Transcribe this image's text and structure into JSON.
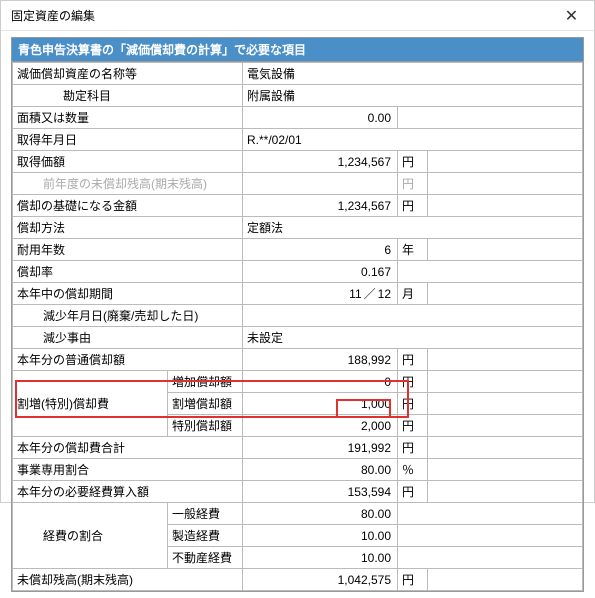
{
  "window": {
    "title": "固定資産の編集"
  },
  "panel": {
    "header": "青色申告決算書の「減価償却費の計算」で必要な項目"
  },
  "rows": {
    "name": {
      "label": "減価償却資産の名称等",
      "value": "電気設備"
    },
    "account": {
      "label": "勘定科目",
      "value": "附属設備"
    },
    "area": {
      "label": "面積又は数量",
      "value": "0.00"
    },
    "acq_date": {
      "label": "取得年月日",
      "value": "R.**/02/01"
    },
    "acq_cost": {
      "label": "取得価額",
      "value": "1,234,567",
      "unit": "円"
    },
    "prev_bal": {
      "label": "前年度の未償却残高(期末残高)",
      "value": "",
      "unit": "円"
    },
    "base": {
      "label": "償却の基礎になる金額",
      "value": "1,234,567",
      "unit": "円"
    },
    "method": {
      "label": "償却方法",
      "value": "定額法"
    },
    "life": {
      "label": "耐用年数",
      "value": "6",
      "unit": "年"
    },
    "rate": {
      "label": "償却率",
      "value": "0.167"
    },
    "period": {
      "label": "本年中の償却期間",
      "v1": "11",
      "v2": "12",
      "unit": "月"
    },
    "dec_date": {
      "label": "減少年月日(廃棄/売却した日)",
      "value": ""
    },
    "dec_reason": {
      "label": "減少事由",
      "value": "未設定"
    },
    "ordinary": {
      "label": "本年分の普通償却額",
      "value": "188,992",
      "unit": "円"
    },
    "special_grp": {
      "label": "割増(特別)償却費"
    },
    "sp_inc": {
      "label": "増加償却額",
      "value": "0",
      "unit": "円"
    },
    "sp_extra": {
      "label": "割増償却額",
      "value": "1,000",
      "unit": "円"
    },
    "sp_special": {
      "label": "特別償却額",
      "value": "2,000",
      "unit": "円"
    },
    "total": {
      "label": "本年分の償却費合計",
      "value": "191,992",
      "unit": "円"
    },
    "biz_ratio": {
      "label": "事業専用割合",
      "value": "80.00",
      "unit": "％"
    },
    "necessary": {
      "label": "本年分の必要経費算入額",
      "value": "153,594",
      "unit": "円"
    },
    "exp_grp": {
      "label": "経費の割合"
    },
    "exp_general": {
      "label": "一般経費",
      "value": "80.00"
    },
    "exp_mfg": {
      "label": "製造経費",
      "value": "10.00"
    },
    "exp_re": {
      "label": "不動産経費",
      "value": "10.00"
    },
    "remaining": {
      "label": "未償却残高(期末残高)",
      "value": "1,042,575",
      "unit": "円"
    }
  }
}
